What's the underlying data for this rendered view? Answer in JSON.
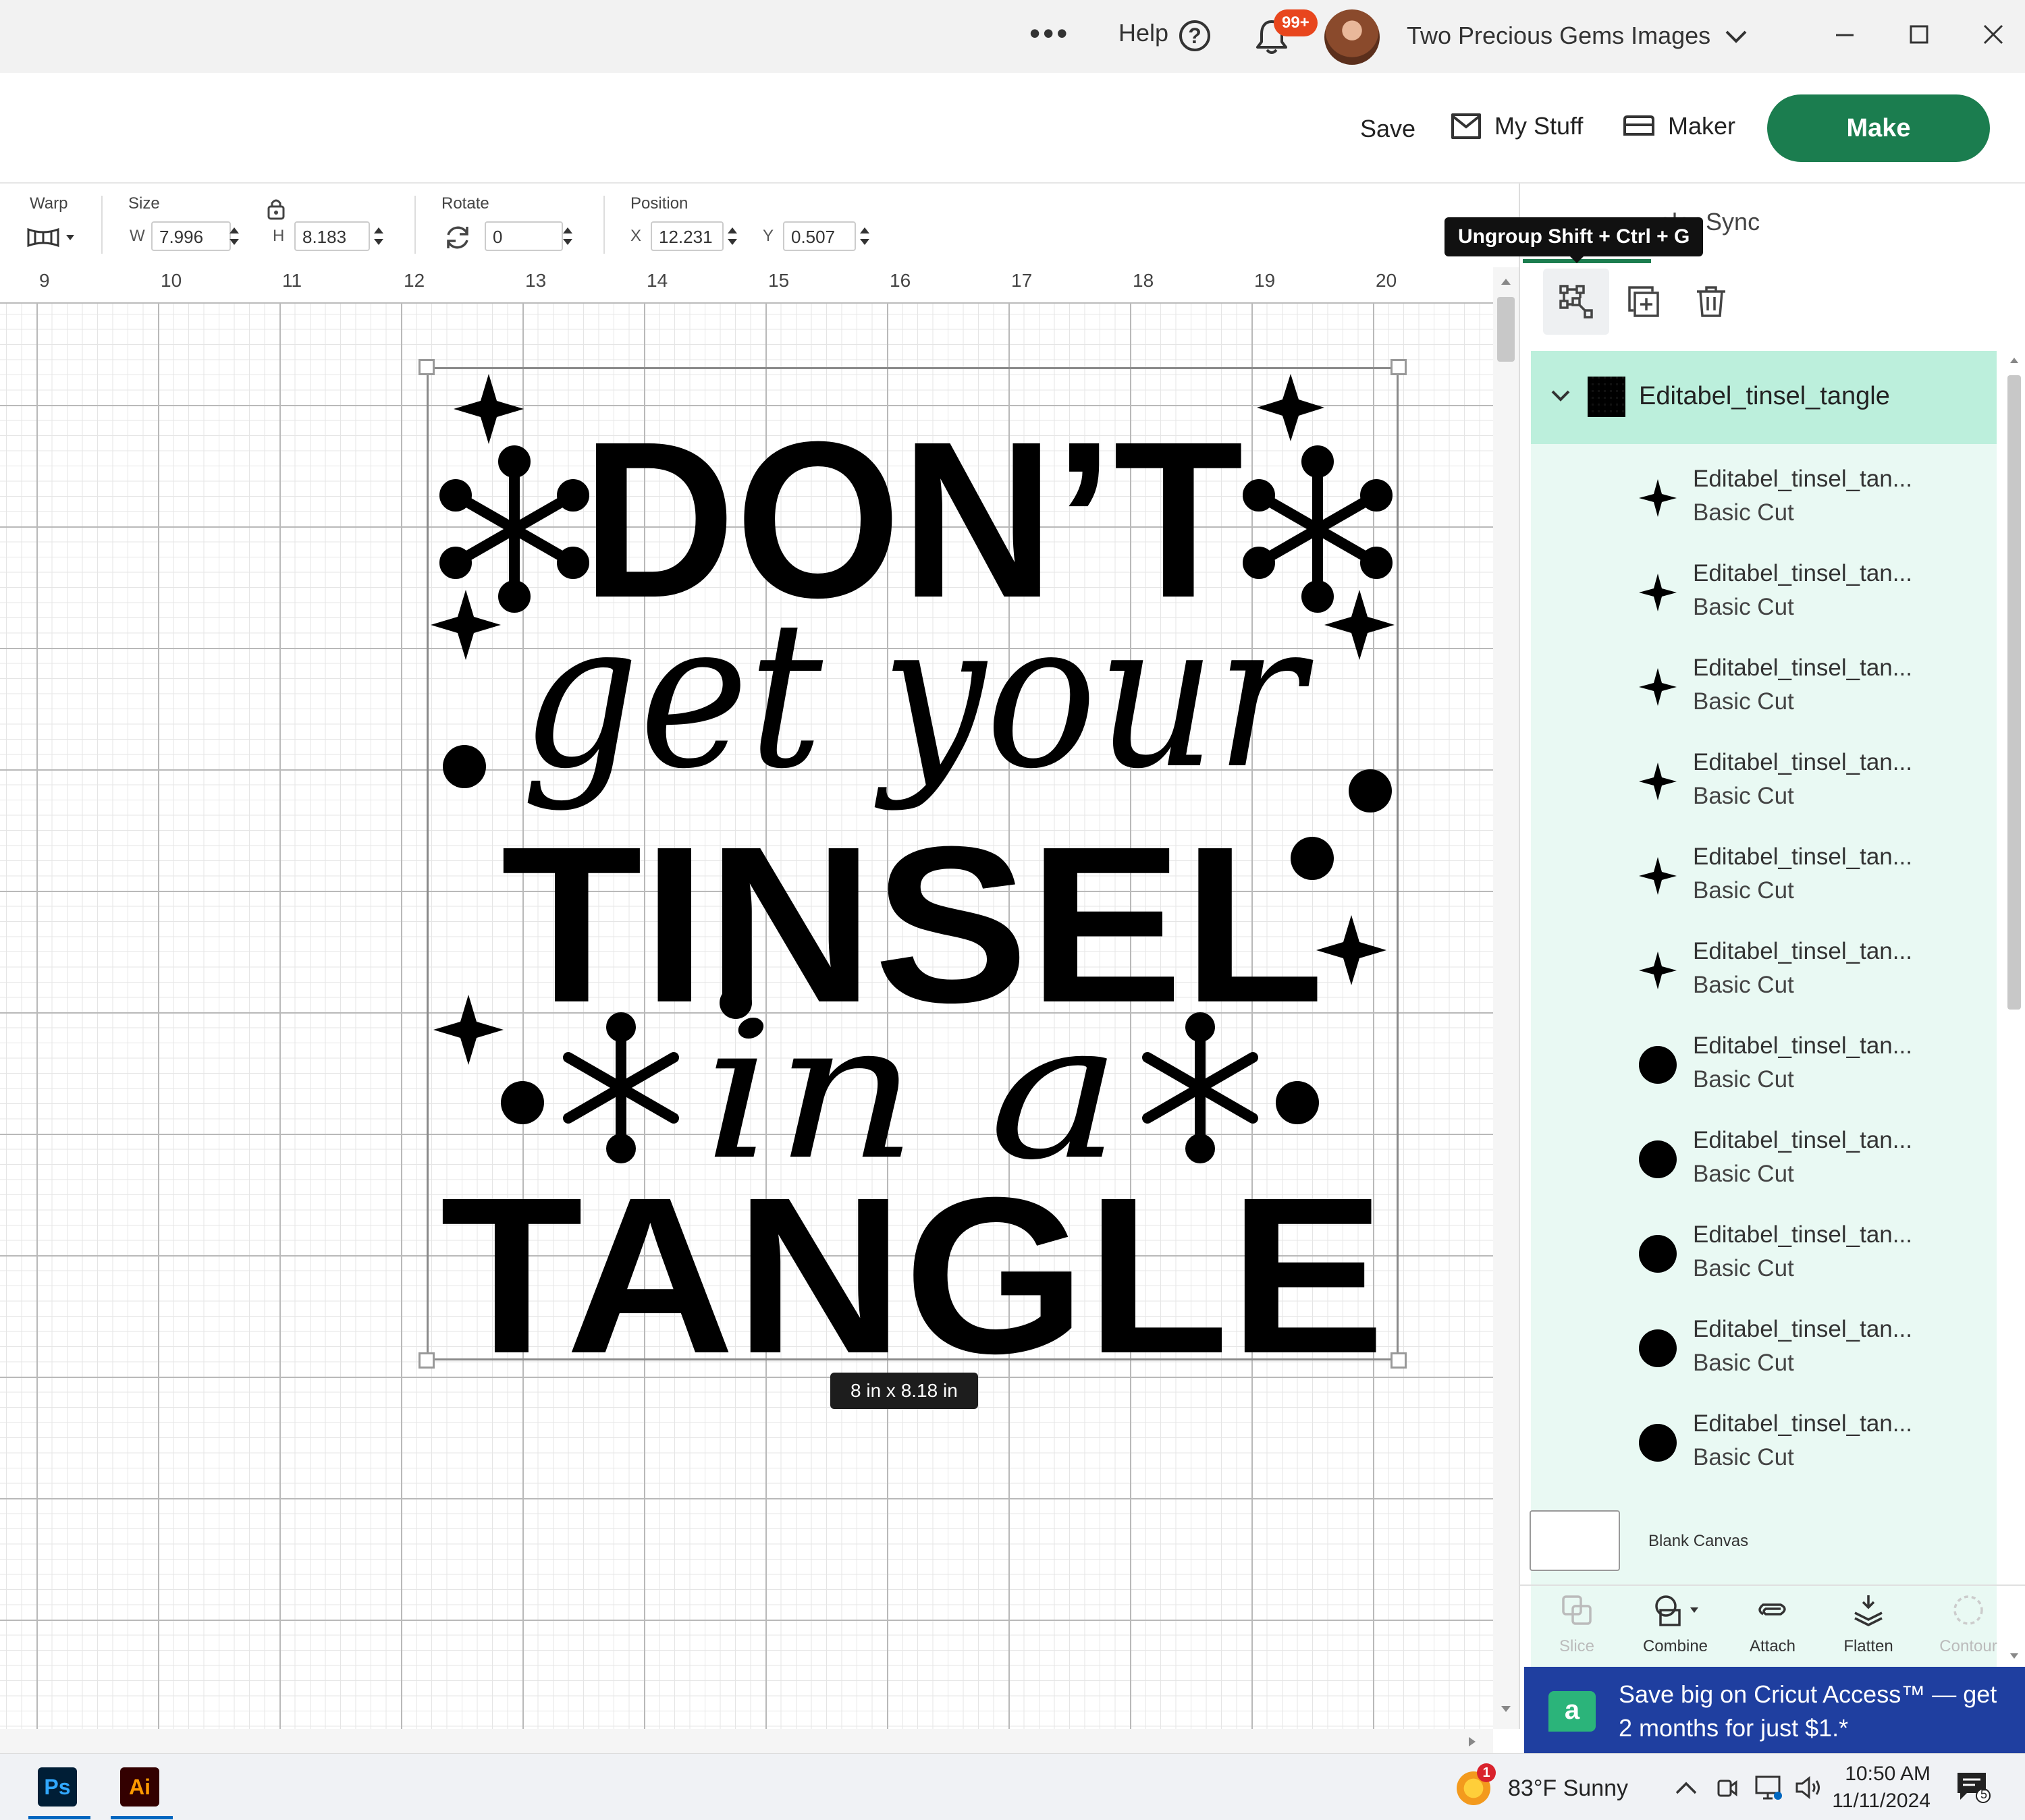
{
  "titlebar": {
    "more_label": "•••",
    "help_label": "Help",
    "help_icon_glyph": "?",
    "notifications_badge": "99+",
    "user_name": "Two Precious Gems Images",
    "icons": [
      "more-icon",
      "help-icon",
      "bell-icon",
      "avatar",
      "chevron-down-icon",
      "minimize-icon",
      "maximize-icon",
      "close-icon"
    ]
  },
  "header": {
    "save_label": "Save",
    "mystuff_label": "My Stuff",
    "maker_label": "Maker",
    "make_label": "Make",
    "make_color": "#1b7d4f"
  },
  "toolbar": {
    "warp_label": "Warp",
    "size_label": "Size",
    "width_prefix": "W",
    "width_value": "7.996",
    "height_prefix": "H",
    "height_value": "8.183",
    "rotate_label": "Rotate",
    "rotate_value": "0",
    "position_label": "Position",
    "x_prefix": "X",
    "x_value": "12.231",
    "y_prefix": "Y",
    "y_value": "0.507"
  },
  "ruler": {
    "ticks": [
      "9",
      "10",
      "11",
      "12",
      "13",
      "14",
      "15",
      "16",
      "17",
      "18",
      "19",
      "20"
    ]
  },
  "canvas": {
    "size_tag": "8  in x 8.18  in",
    "artwork_lines": [
      "DON’T",
      "get your",
      "TINSEL",
      "in a",
      "TANGLE"
    ]
  },
  "panel": {
    "tab_partial_label": "olor Sync",
    "tooltip": "Ungroup Shift + Ctrl + G",
    "group_name": "Editabel_tinsel_tangle",
    "layers": [
      {
        "name": "Editabel_tinsel_tan...",
        "op": "Basic Cut",
        "icon": "star"
      },
      {
        "name": "Editabel_tinsel_tan...",
        "op": "Basic Cut",
        "icon": "star"
      },
      {
        "name": "Editabel_tinsel_tan...",
        "op": "Basic Cut",
        "icon": "star"
      },
      {
        "name": "Editabel_tinsel_tan...",
        "op": "Basic Cut",
        "icon": "star"
      },
      {
        "name": "Editabel_tinsel_tan...",
        "op": "Basic Cut",
        "icon": "star"
      },
      {
        "name": "Editabel_tinsel_tan...",
        "op": "Basic Cut",
        "icon": "star"
      },
      {
        "name": "Editabel_tinsel_tan...",
        "op": "Basic Cut",
        "icon": "circle"
      },
      {
        "name": "Editabel_tinsel_tan...",
        "op": "Basic Cut",
        "icon": "circle"
      },
      {
        "name": "Editabel_tinsel_tan...",
        "op": "Basic Cut",
        "icon": "circle"
      },
      {
        "name": "Editabel_tinsel_tan...",
        "op": "Basic Cut",
        "icon": "circle"
      },
      {
        "name": "Editabel_tinsel_tan...",
        "op": "Basic Cut",
        "icon": "circle"
      }
    ],
    "blank_canvas_label": "Blank Canvas",
    "bottom_tools": {
      "slice": "Slice",
      "combine": "Combine",
      "attach": "Attach",
      "flatten": "Flatten",
      "contour": "Contour"
    },
    "promo": {
      "icon_letter": "a",
      "text": "Save big on Cricut Access™ — get 2 months for just $1.*"
    },
    "layer_bg": "#e9f9f3",
    "group_bg": "#bcefdc"
  },
  "taskbar": {
    "ps_label": "Ps",
    "ai_label": "Ai",
    "weather_badge": "1",
    "weather_text": "83°F  Sunny",
    "time": "10:50 AM",
    "date": "11/11/2024",
    "notif_count": "5"
  }
}
